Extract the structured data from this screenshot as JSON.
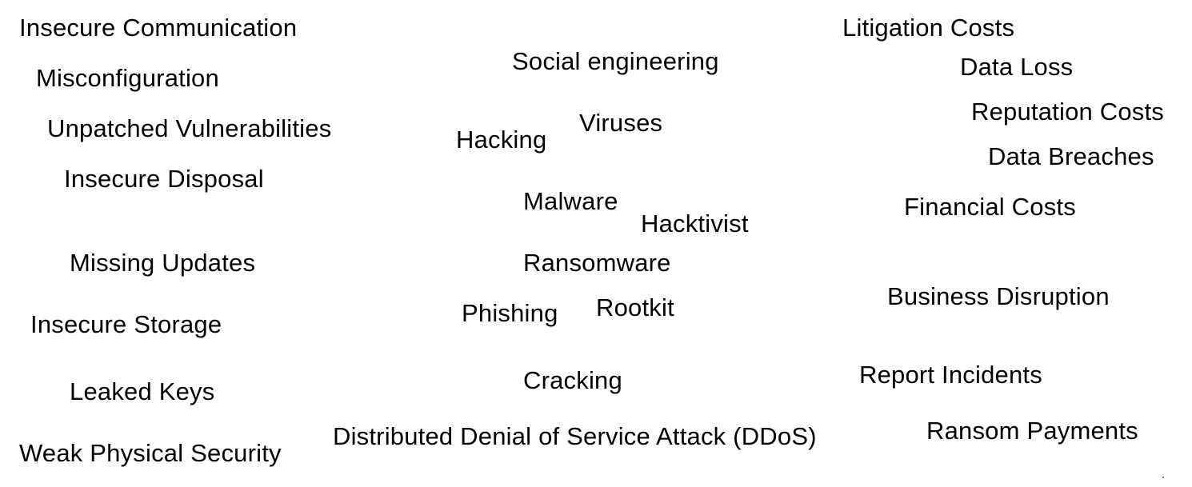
{
  "vulnerabilities": [
    "Insecure Communication",
    "Misconfiguration",
    "Unpatched Vulnerabilities",
    "Insecure Disposal",
    "Missing Updates",
    "Insecure Storage",
    "Leaked Keys",
    "Weak Physical Security"
  ],
  "threats": [
    "Social engineering",
    "Hacking",
    "Viruses",
    "Malware",
    "Hacktivist",
    "Ransomware",
    "Phishing",
    "Rootkit",
    "Cracking",
    "Distributed Denial of Service Attack (DDoS)"
  ],
  "impacts": [
    "Litigation Costs",
    "Data Loss",
    "Reputation Costs",
    "Data Breaches",
    "Financial Costs",
    "Business Disruption",
    "Report Incidents",
    "Ransom Payments"
  ]
}
